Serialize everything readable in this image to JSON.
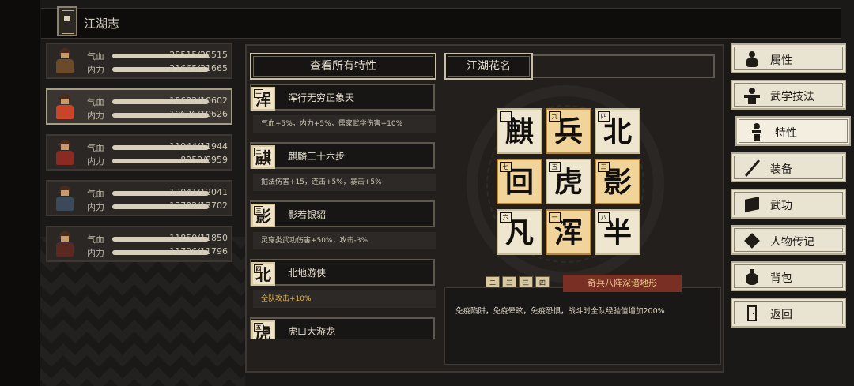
{
  "title": "江湖志",
  "characters": [
    {
      "hp_label": "气血",
      "mp_label": "内力",
      "hp": "28515/28515",
      "mp": "21665/21665",
      "selected": false
    },
    {
      "hp_label": "气血",
      "mp_label": "内力",
      "hp": "10602/10602",
      "mp": "10626/10626",
      "selected": true
    },
    {
      "hp_label": "气血",
      "mp_label": "内力",
      "hp": "11944/11944",
      "mp": "8959/8959",
      "selected": false
    },
    {
      "hp_label": "气血",
      "mp_label": "内力",
      "hp": "12041/12041",
      "mp": "13702/13702",
      "selected": false
    },
    {
      "hp_label": "气血",
      "mp_label": "内力",
      "hp": "11850/11850",
      "mp": "11796/11796",
      "selected": false
    }
  ],
  "traits_header": "查看所有特性",
  "nickname_header": "江湖花名",
  "traits": [
    {
      "char": "浑",
      "num": "一",
      "name": "浑行无穷正象天",
      "desc": "气血+5%，内力+5%，儒家武学伤害+10%",
      "gold": false
    },
    {
      "char": "麒",
      "num": "二",
      "name": "麒麟三十六步",
      "desc": "掘法伤害+15，连击+5%，暴击+5%",
      "gold": false
    },
    {
      "char": "影",
      "num": "三",
      "name": "影若银貂",
      "desc": "灵穿类武功伤害+50%，攻击-3%",
      "gold": false
    },
    {
      "char": "北",
      "num": "四",
      "name": "北地游侠",
      "desc": "全队攻击+10%",
      "gold": true
    },
    {
      "char": "虎",
      "num": "五",
      "name": "虎口大游龙",
      "desc": "",
      "gold": false
    }
  ],
  "grid": [
    [
      {
        "c": "麒",
        "n": "二",
        "gold": false
      },
      {
        "c": "兵",
        "n": "九",
        "gold": true
      },
      {
        "c": "北",
        "n": "四",
        "gold": false
      }
    ],
    [
      {
        "c": "回",
        "n": "七",
        "gold": true
      },
      {
        "c": "虎",
        "n": "五",
        "gold": false
      },
      {
        "c": "影",
        "n": "三",
        "gold": true
      }
    ],
    [
      {
        "c": "凡",
        "n": "六",
        "gold": false
      },
      {
        "c": "浑",
        "n": "一",
        "gold": true
      },
      {
        "c": "半",
        "n": "八",
        "gold": false
      }
    ]
  ],
  "effect_chips": [
    "二",
    "三",
    "三",
    "四"
  ],
  "effect_title": "奇兵八阵深谙地形",
  "effect_text": "免疫陷阱，免疫晕眩，免疫恐惧，战斗时全队经验值增加200%",
  "menu": [
    {
      "label": "属性",
      "icon": "person-icon",
      "active": false
    },
    {
      "label": "武学技法",
      "icon": "martial-arts-icon",
      "active": false
    },
    {
      "label": "特性",
      "icon": "trait-icon",
      "active": true
    },
    {
      "label": "装备",
      "icon": "sword-icon",
      "active": false
    },
    {
      "label": "武功",
      "icon": "book-icon",
      "active": false
    },
    {
      "label": "人物传记",
      "icon": "biography-icon",
      "active": false
    },
    {
      "label": "背包",
      "icon": "bag-icon",
      "active": false
    },
    {
      "label": "返回",
      "icon": "exit-door-icon",
      "active": false
    }
  ],
  "colors": {
    "gold_tile": "#f1d49a",
    "ivory_tile": "#eee6cf",
    "banner_red": "#7a2f24",
    "gold_text": "#e0b24a"
  }
}
